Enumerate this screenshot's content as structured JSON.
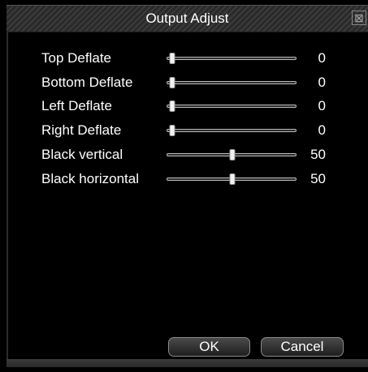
{
  "window": {
    "title": "Output Adjust",
    "close_glyph": "⊠"
  },
  "settings": [
    {
      "label": "Top Deflate",
      "value": "0",
      "level": 0
    },
    {
      "label": "Bottom Deflate",
      "value": "0",
      "level": 0
    },
    {
      "label": "Left Deflate",
      "value": "0",
      "level": 0
    },
    {
      "label": "Right Deflate",
      "value": "0",
      "level": 0
    },
    {
      "label": "Black vertical",
      "value": "50",
      "level": 0.5
    },
    {
      "label": "Black horizontal",
      "value": "50",
      "level": 0.5
    }
  ],
  "buttons": {
    "ok": "OK",
    "cancel": "Cancel"
  },
  "icons": {
    "close": "close-icon"
  }
}
